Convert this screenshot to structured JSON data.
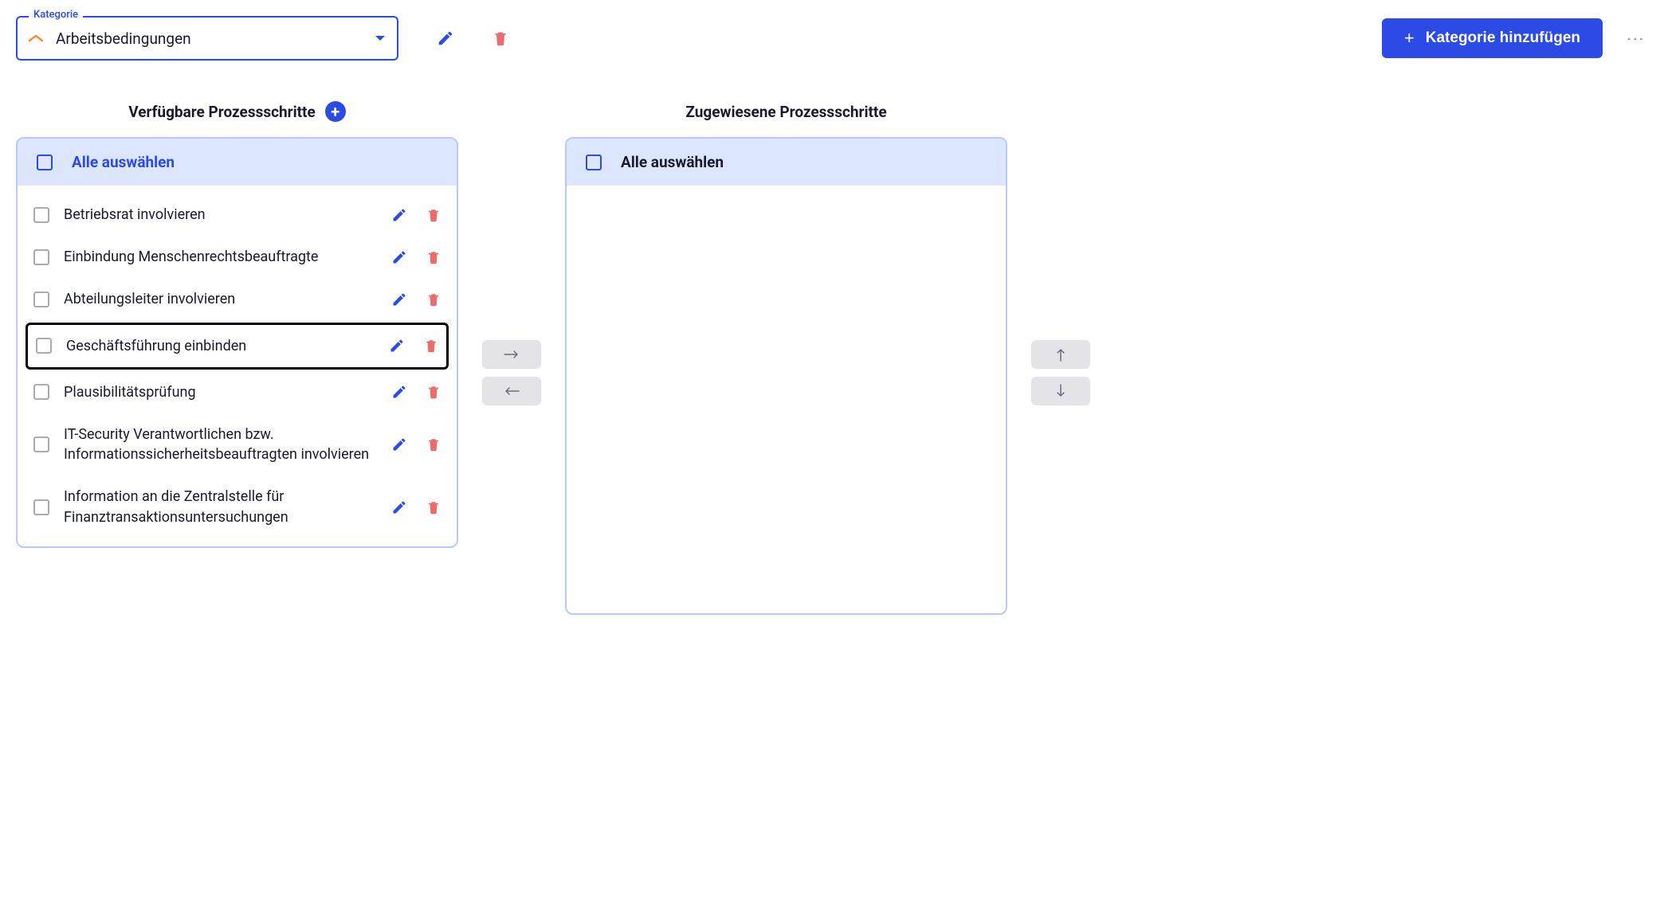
{
  "category": {
    "legend": "Kategorie",
    "value": "Arbeitsbedingungen"
  },
  "add_category_label": "Kategorie hinzufügen",
  "available": {
    "title": "Verfügbare Prozessschritte",
    "select_all": "Alle auswählen",
    "items": [
      {
        "label": "Betriebsrat involvieren",
        "highlighted": false
      },
      {
        "label": "Einbindung Menschenrechtsbeauftragte",
        "highlighted": false
      },
      {
        "label": "Abteilungsleiter involvieren",
        "highlighted": false
      },
      {
        "label": "Geschäftsführung einbinden",
        "highlighted": true
      },
      {
        "label": "Plausibilitätsprüfung",
        "highlighted": false
      },
      {
        "label": "IT-Security Verantwortlichen bzw. Informationssicherheitsbeauftragten involvieren",
        "highlighted": false
      },
      {
        "label": "Information an die Zentralstelle für Finanztransaktionsuntersuchungen",
        "highlighted": false
      }
    ]
  },
  "assigned": {
    "title": "Zugewiesene Prozessschritte",
    "select_all": "Alle auswählen",
    "items": []
  }
}
